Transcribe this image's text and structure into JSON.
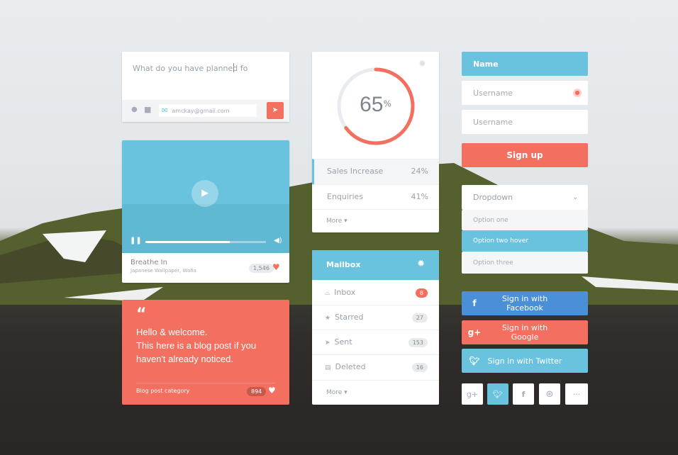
{
  "colors": {
    "accent_blue": "#6ac3de",
    "accent_coral": "#f36f5f",
    "facebook": "#4a90d9"
  },
  "composer": {
    "placeholder": "What do you have planned fo",
    "email": "amckay@gmail.com",
    "icons": [
      "map-pin-icon",
      "camera-icon",
      "envelope-icon",
      "send-icon"
    ]
  },
  "player": {
    "title": "Breathe In",
    "subtitle": "Japanese Wallpaper, Wafia",
    "count": "1,546",
    "progress": 0.7
  },
  "blog": {
    "quote": "“",
    "line1": "Hello & welcome.",
    "line2": "This here is a blog post if you",
    "line3": "haven't already noticed.",
    "category": "Blog post category",
    "count": "894"
  },
  "stats": {
    "percent_value": "65",
    "percent_sign": "%",
    "progress": 0.65,
    "rows": [
      {
        "label": "Sales Increase",
        "value": "24%"
      },
      {
        "label": "Enquiries",
        "value": "41%"
      }
    ],
    "more": "More"
  },
  "mailbox": {
    "title": "Mailbox",
    "items": [
      {
        "label": "Inbox",
        "count": "8",
        "icon": "inbox-icon"
      },
      {
        "label": "Starred",
        "count": "27",
        "icon": "star-icon"
      },
      {
        "label": "Sent",
        "count": "153",
        "icon": "send-icon"
      },
      {
        "label": "Deleted",
        "count": "16",
        "icon": "trash-icon"
      }
    ],
    "more": "More"
  },
  "form": {
    "name": "Name",
    "username1": "Username",
    "username2": "Username",
    "signup": "Sign up"
  },
  "dropdown": {
    "label": "Dropdown",
    "options": [
      "Option one",
      "Option two hover",
      "Option three"
    ]
  },
  "social": {
    "facebook": "Sign in with Facebook",
    "google": "Sign in with Google",
    "twitter": "Sign in with Twitter",
    "fb_glyph": "f",
    "g_glyph": "g+",
    "more_glyph": "···"
  }
}
